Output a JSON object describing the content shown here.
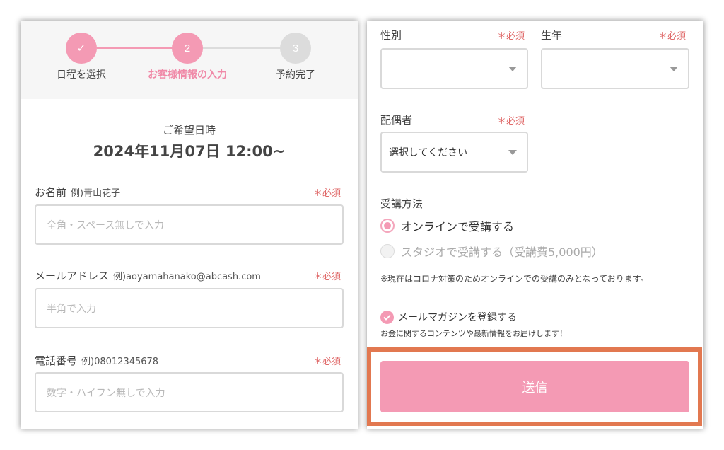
{
  "stepper": {
    "steps": [
      {
        "number": "✓",
        "label": "日程を選択",
        "state": "done"
      },
      {
        "number": "2",
        "label": "お客様情報の入力",
        "state": "current"
      },
      {
        "number": "3",
        "label": "予約完了",
        "state": "todo"
      }
    ],
    "colors": {
      "active": "#f49ab4",
      "inactive": "#dcdcdc",
      "active_label": "#f08aa8",
      "inactive_label": "#444444"
    }
  },
  "booking": {
    "date_title": "ご希望日時",
    "date_value": "2024年11月07日 12:00~"
  },
  "required_text": "＊必須",
  "form": {
    "name": {
      "label": "お名前",
      "example": "例)青山花子",
      "placeholder": "全角・スペース無しで入力"
    },
    "email": {
      "label": "メールアドレス",
      "example": "例)aoyamahanako@abcash.com",
      "placeholder": "半角で入力"
    },
    "phone": {
      "label": "電話番号",
      "example": "例)08012345678",
      "placeholder": "数字・ハイフン無しで入力"
    },
    "gender": {
      "label": "性別",
      "value": ""
    },
    "birth_year": {
      "label": "生年",
      "value": ""
    },
    "spouse": {
      "label": "配偶者",
      "value": "選択してください"
    },
    "attendance": {
      "label": "受講方法",
      "options": [
        {
          "label": "オンラインで受講する",
          "selected": true
        },
        {
          "label": "スタジオで受講する（受講費5,000円）",
          "selected": false
        }
      ],
      "note": "※現在はコロナ対策のためオンラインでの受講のみとなっております。"
    },
    "newsletter": {
      "label": "メールマガジンを登録する",
      "checked": true,
      "description": "お金に関するコンテンツや最新情報をお届けします！"
    },
    "submit_label": "送信"
  },
  "colors": {
    "accent": "#f49ab4",
    "required": "#e06a6a",
    "highlight_frame": "#e27850"
  }
}
